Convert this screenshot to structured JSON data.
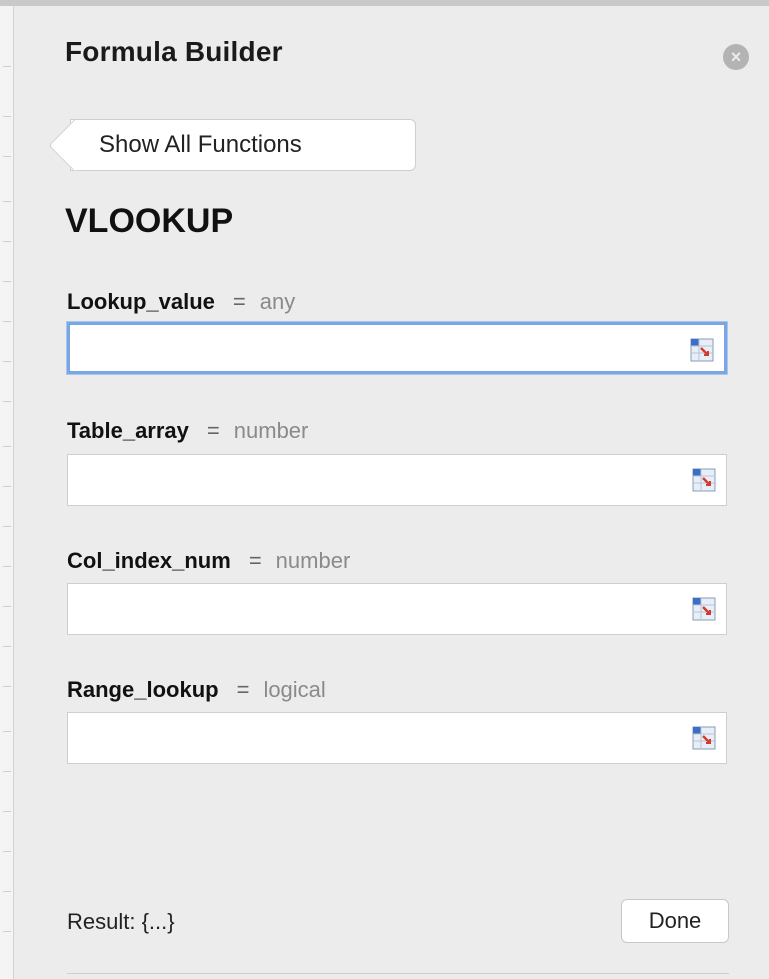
{
  "panel": {
    "title": "Formula Builder",
    "back_label": "Show All Functions",
    "function_name": "VLOOKUP"
  },
  "arguments": [
    {
      "name": "Lookup_value",
      "equals": "=",
      "type": "any",
      "value": ""
    },
    {
      "name": "Table_array",
      "equals": "=",
      "type": "number",
      "value": ""
    },
    {
      "name": "Col_index_num",
      "equals": "=",
      "type": "number",
      "value": ""
    },
    {
      "name": "Range_lookup",
      "equals": "=",
      "type": "logical",
      "value": ""
    }
  ],
  "footer": {
    "result": "Result: {...}",
    "done_label": "Done"
  },
  "icons": {
    "close": "close-icon",
    "range_picker": "range-select-icon"
  },
  "colors": {
    "focus_ring": "#7aa7e3",
    "panel_bg": "#ececec"
  }
}
